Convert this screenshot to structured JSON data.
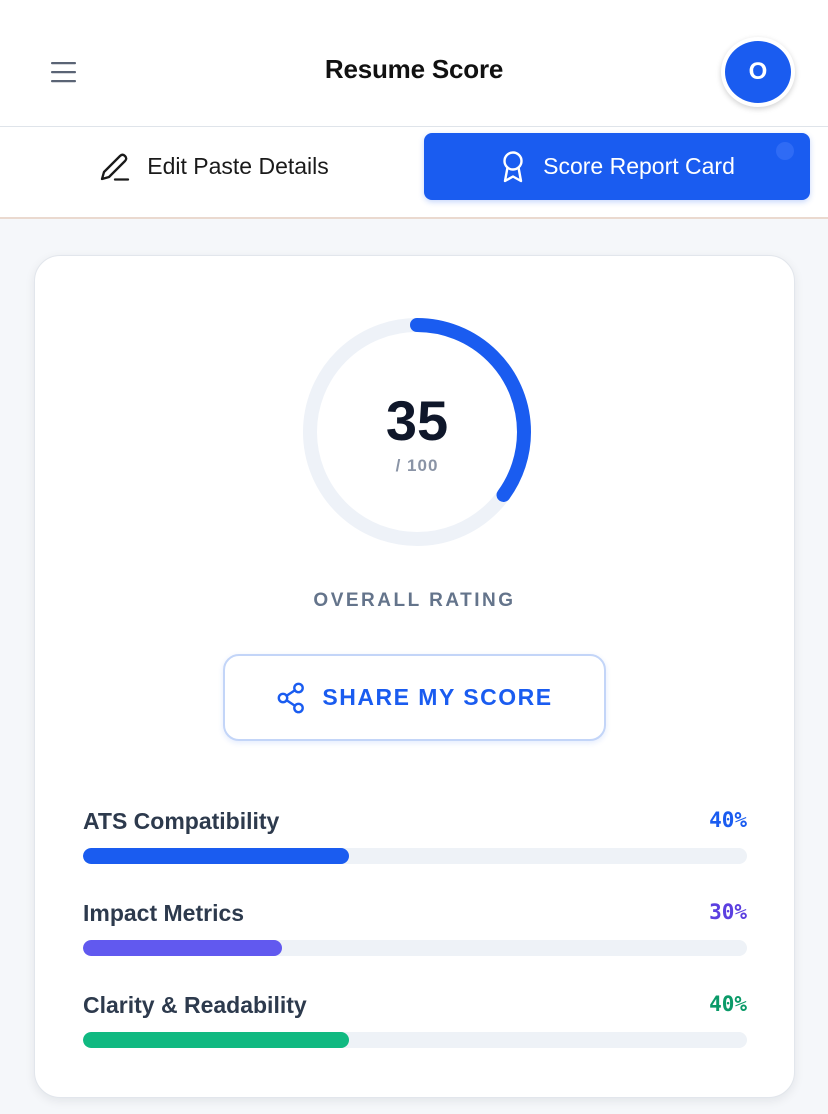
{
  "header": {
    "title": "Resume Score",
    "avatar_initial": "O",
    "menu_icon": "hamburger-icon"
  },
  "tabs": [
    {
      "label": "Edit Paste Details",
      "icon": "pencil-icon",
      "active": false
    },
    {
      "label": "Score Report Card",
      "icon": "award-icon",
      "active": true
    }
  ],
  "score": {
    "value": "35",
    "max_label": "/ 100",
    "fraction": 0.35,
    "label": "OVERALL RATING"
  },
  "share": {
    "label": "SHARE MY SCORE",
    "icon": "share-icon"
  },
  "metrics": [
    {
      "name": "ATS Compatibility",
      "percent_label": "40%",
      "value": 40,
      "color": "#1a5cf0"
    },
    {
      "name": "Impact Metrics",
      "percent_label": "30%",
      "value": 30,
      "color": "#6159ef"
    },
    {
      "name": "Clarity & Readability",
      "percent_label": "40%",
      "value": 40,
      "color": "#10b981"
    }
  ],
  "colors": {
    "accent": "#1a5cf0",
    "gauge_track": "#eef2f8",
    "impact_text": "#5b3fe0",
    "clarity_text": "#0a9a68"
  }
}
